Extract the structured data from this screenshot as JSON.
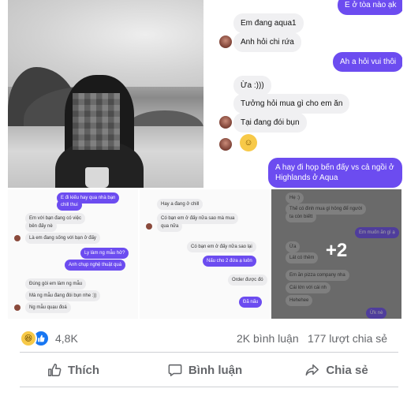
{
  "chat": {
    "top_out_label": "E ở tòa nào ạk",
    "m1": "Em đang aqua1",
    "m2": "Anh hỏi chi rứa",
    "m3": "Ah a hỏi vui thôi",
    "m4": "Ừa :)))",
    "m5": "Tưởng hỏi mua gì cho em ăn",
    "m6": "Tại đang đói bụn",
    "m7_line1": "A hay đi họp bến đấy vs cả ngồi ở",
    "m7_line2": "Highlands ở Aqua"
  },
  "tile_b1": {
    "l1": "E đi kiếu hay qua nhà bạn",
    "l2": "chill thui",
    "l3": "Em với bạn đang có việc",
    "l4": "bên đấy nè",
    "l5": "Là em đang sống với bạn ở đấy",
    "l6": "Ly làm ng mẫu hở?",
    "l7": "Anh chụp nghệ thuật quá",
    "l8": "Đúng gòi em làm ng mẫu",
    "l9": "Mà ng mẫu đang đói bụn nhe :))",
    "l10": "Ng mẫu quạu đoá"
  },
  "tile_b2": {
    "l1": "Hay a đang ở chill",
    "l2": "Có bạn em ở đấy nữa sao mà mua",
    "l3": "qua nữa",
    "l4": "Có bạn em ở đấy nữa sao lại",
    "l5": "Nấu cho 2 đứa ạ luôn",
    "l6": "Order được đó",
    "l7": "Đã nấu"
  },
  "tile_b3": {
    "l1": "Hẹ :)",
    "l2": "Thế có đinh mua gì hông để người",
    "l3": "ta còn biếtt",
    "l4": "Em muốn ăn gì ạ",
    "l5": "Ừa",
    "l6": "Lát có thêm",
    "l7": "Em ăn pizza company nha",
    "l8": "Cái lớn với cái nh",
    "l9": "Hehehee",
    "l10": "Ừk nè",
    "more_label": "+2"
  },
  "reactions": {
    "count": "4,8K",
    "comments": "2K bình luận",
    "shares": "177 lượt chia sẻ",
    "icons": [
      "haha-icon",
      "like-icon"
    ]
  },
  "actions": {
    "like": "Thích",
    "comment": "Bình luận",
    "share": "Chia sẻ"
  },
  "colors": {
    "messenger_purple": "#6c4cf0",
    "like_blue": "#1877f2",
    "muted_text": "#65676b"
  }
}
